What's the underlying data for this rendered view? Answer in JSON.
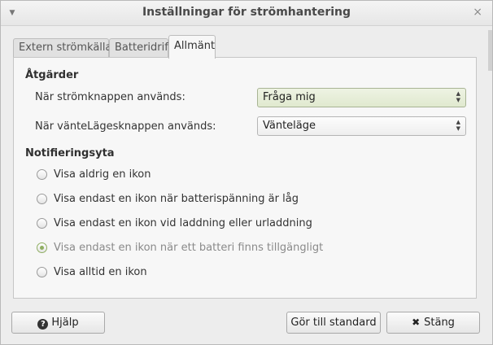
{
  "window": {
    "title": "Inställningar för strömhantering"
  },
  "tabs": [
    {
      "label": "Extern strömkälla",
      "active": false
    },
    {
      "label": "Batteridrift",
      "active": false
    },
    {
      "label": "Allmänt",
      "active": true
    }
  ],
  "actions": {
    "heading": "Åtgärder",
    "power_button_label": "När strömknappen används:",
    "power_button_value": "Fråga mig",
    "suspend_button_label": "När vänteLägesknappen används:",
    "suspend_button_value": "Vänteläge"
  },
  "notification": {
    "heading": "Notifieringsyta",
    "options": [
      {
        "label": "Visa aldrig en ikon",
        "checked": false
      },
      {
        "label": "Visa endast en ikon när batterispänning är låg",
        "checked": false
      },
      {
        "label": "Visa endast en ikon vid laddning eller urladdning",
        "checked": false
      },
      {
        "label": "Visa endast en ikon när ett batteri finns tillgängligt",
        "checked": true
      },
      {
        "label": "Visa alltid en ikon",
        "checked": false
      }
    ]
  },
  "buttons": {
    "help": "Hjälp",
    "defaults": "Gör till standard",
    "close": "Stäng"
  },
  "colors": {
    "accent": "#8fae62",
    "focused_combo": "#e0e9cf"
  }
}
